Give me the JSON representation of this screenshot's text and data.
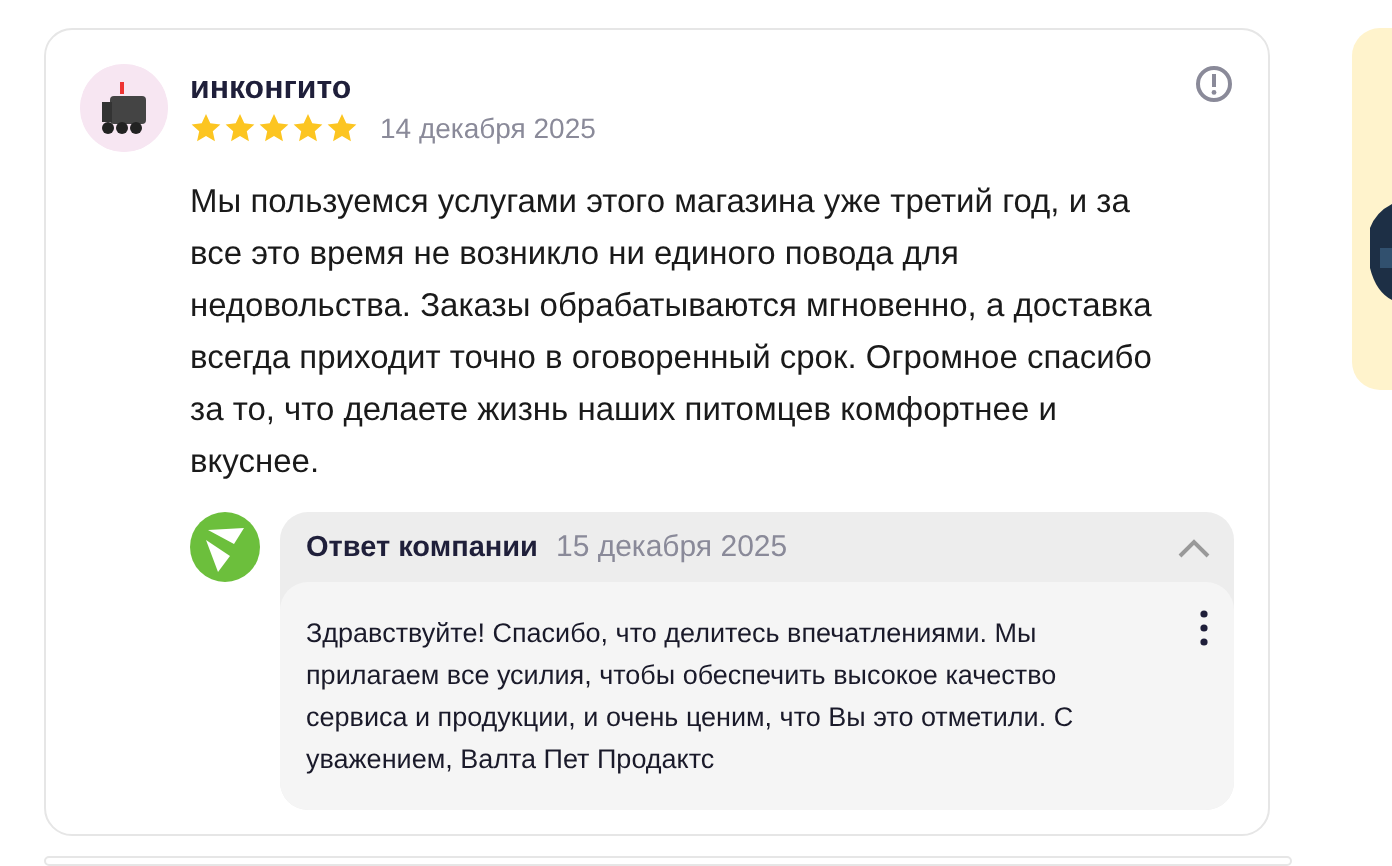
{
  "review": {
    "author": "инконгито",
    "stars": 5,
    "date": "14 декабря 2025",
    "text": "Мы пользуемся услугами этого магазина уже третий год, и за все это время не возникло ни единого повода для недовольства. Заказы обрабатываются мгновенно, а доставка всегда приходит точно в оговоренный срок. Огромное спасибо за то, что делаете жизнь наших питомцев комфортнее и вкуснее.",
    "reply": {
      "title": "Ответ компании",
      "date": "15 декабря 2025",
      "expanded": true,
      "text": "Здравствуйте! Спасибо, что делитесь впечатлениями. Мы прилагаем все усилия, чтобы обеспечить высокое качество сервиса и продукции, и очень ценим, что Вы это отметили. С уважением, Валта Пет Продактс"
    }
  }
}
